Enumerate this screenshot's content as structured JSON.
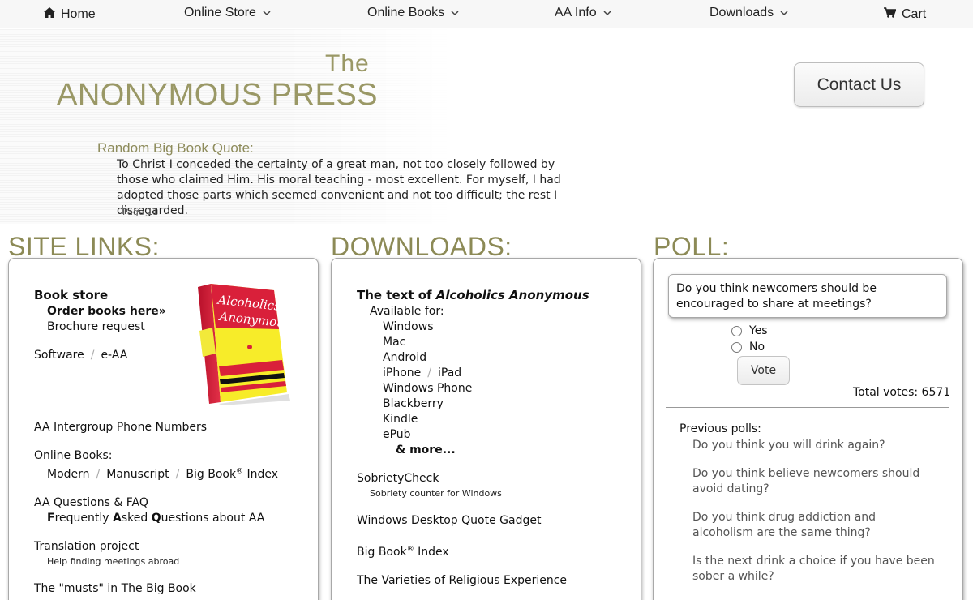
{
  "nav": {
    "home": "Home",
    "online_store": "Online Store",
    "online_books": "Online Books",
    "aa_info": "AA Info",
    "downloads": "Downloads",
    "cart": "Cart"
  },
  "header": {
    "logo_the": "The",
    "logo_main": "ANONYMOUS PRESS",
    "contact": "Contact Us",
    "quote_title": "Random Big Book Quote:",
    "quote_text": "To Christ I conceded the certainty of a great man, not too closely followed by those who claimed Him. His moral teaching - most excellent. For myself, I had adopted those parts which seemed convenient and not too difficult; the rest I disregarded.",
    "quote_page": "Page 11"
  },
  "sections": {
    "links": "SITE LINKS:",
    "downloads": "DOWNLOADS:",
    "poll": "POLL:"
  },
  "site_links": {
    "book_store": "Book store",
    "order_books": "Order books here",
    "order_arrow": "»",
    "brochure": "Brochure request",
    "software": "Software",
    "eaa": "e-AA",
    "sep": "/",
    "phone_numbers": "AA Intergroup Phone Numbers",
    "online_books": "Online Books:",
    "modern": "Modern",
    "manuscript": "Manuscript",
    "bigbook_index": "Big Book",
    "index_word": "Index",
    "reg": "®",
    "faq": "AA Questions & FAQ",
    "faq_sub_f": "F",
    "faq_sub_1": "requently ",
    "faq_sub_a": "A",
    "faq_sub_2": "sked ",
    "faq_sub_q": "Q",
    "faq_sub_3": "uestions about AA",
    "translation": "Translation project",
    "translation_sub": "Help finding meetings abroad",
    "musts": "The \"musts\" in The Big Book",
    "book_cover_title": "Alcoholics Anonymous"
  },
  "downloads": {
    "text_of": "The text of ",
    "aa_title": "Alcoholics Anonymous",
    "available": "Available for:",
    "platforms": [
      "Windows",
      "Mac",
      "Android"
    ],
    "iphone": "iPhone",
    "ipad": "iPad",
    "platforms2": [
      "Windows Phone",
      "Blackberry",
      "Kindle",
      "ePub"
    ],
    "more": "& more...",
    "sobriety": "SobrietyCheck",
    "sobriety_sub": "Sobriety counter for Windows",
    "gadget": "Windows Desktop Quote Gadget",
    "bigbook": "Big Book",
    "index": "Index",
    "varieties": "The Varieties of Religious Experience"
  },
  "poll": {
    "question": "Do you think newcomers should be encouraged to share at meetings?",
    "yes": "Yes",
    "no": "No",
    "vote": "Vote",
    "total": "Total votes: 6571",
    "previous_label": "Previous polls:",
    "previous": [
      "Do you think you will drink again?",
      "Do you think believe newcomers should avoid dating?",
      "Do you think drug addiction and alcoholism are the same thing?",
      "Is the next drink a choice if you have been sober a while?"
    ]
  },
  "colors": {
    "brand_olive": "#9a9866",
    "nav_bg": "#f7f7f7",
    "panel_border": "#a8a8a8"
  },
  "icons": {
    "home": "home-icon",
    "cart": "cart-icon",
    "dropdown": "chevron-down-icon"
  }
}
